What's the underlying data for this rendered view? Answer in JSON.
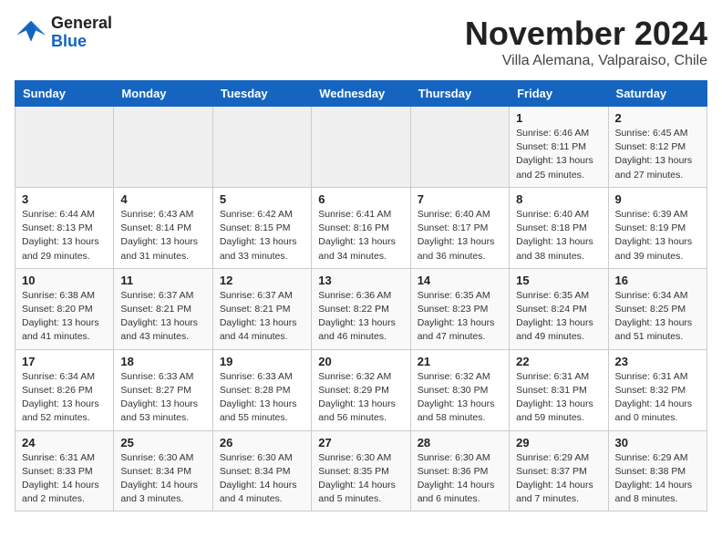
{
  "header": {
    "logo_general": "General",
    "logo_blue": "Blue",
    "month": "November 2024",
    "location": "Villa Alemana, Valparaiso, Chile"
  },
  "weekdays": [
    "Sunday",
    "Monday",
    "Tuesday",
    "Wednesday",
    "Thursday",
    "Friday",
    "Saturday"
  ],
  "weeks": [
    [
      {
        "day": "",
        "sunrise": "",
        "sunset": "",
        "daylight": ""
      },
      {
        "day": "",
        "sunrise": "",
        "sunset": "",
        "daylight": ""
      },
      {
        "day": "",
        "sunrise": "",
        "sunset": "",
        "daylight": ""
      },
      {
        "day": "",
        "sunrise": "",
        "sunset": "",
        "daylight": ""
      },
      {
        "day": "",
        "sunrise": "",
        "sunset": "",
        "daylight": ""
      },
      {
        "day": "1",
        "sunrise": "Sunrise: 6:46 AM",
        "sunset": "Sunset: 8:11 PM",
        "daylight": "Daylight: 13 hours and 25 minutes."
      },
      {
        "day": "2",
        "sunrise": "Sunrise: 6:45 AM",
        "sunset": "Sunset: 8:12 PM",
        "daylight": "Daylight: 13 hours and 27 minutes."
      }
    ],
    [
      {
        "day": "3",
        "sunrise": "Sunrise: 6:44 AM",
        "sunset": "Sunset: 8:13 PM",
        "daylight": "Daylight: 13 hours and 29 minutes."
      },
      {
        "day": "4",
        "sunrise": "Sunrise: 6:43 AM",
        "sunset": "Sunset: 8:14 PM",
        "daylight": "Daylight: 13 hours and 31 minutes."
      },
      {
        "day": "5",
        "sunrise": "Sunrise: 6:42 AM",
        "sunset": "Sunset: 8:15 PM",
        "daylight": "Daylight: 13 hours and 33 minutes."
      },
      {
        "day": "6",
        "sunrise": "Sunrise: 6:41 AM",
        "sunset": "Sunset: 8:16 PM",
        "daylight": "Daylight: 13 hours and 34 minutes."
      },
      {
        "day": "7",
        "sunrise": "Sunrise: 6:40 AM",
        "sunset": "Sunset: 8:17 PM",
        "daylight": "Daylight: 13 hours and 36 minutes."
      },
      {
        "day": "8",
        "sunrise": "Sunrise: 6:40 AM",
        "sunset": "Sunset: 8:18 PM",
        "daylight": "Daylight: 13 hours and 38 minutes."
      },
      {
        "day": "9",
        "sunrise": "Sunrise: 6:39 AM",
        "sunset": "Sunset: 8:19 PM",
        "daylight": "Daylight: 13 hours and 39 minutes."
      }
    ],
    [
      {
        "day": "10",
        "sunrise": "Sunrise: 6:38 AM",
        "sunset": "Sunset: 8:20 PM",
        "daylight": "Daylight: 13 hours and 41 minutes."
      },
      {
        "day": "11",
        "sunrise": "Sunrise: 6:37 AM",
        "sunset": "Sunset: 8:21 PM",
        "daylight": "Daylight: 13 hours and 43 minutes."
      },
      {
        "day": "12",
        "sunrise": "Sunrise: 6:37 AM",
        "sunset": "Sunset: 8:21 PM",
        "daylight": "Daylight: 13 hours and 44 minutes."
      },
      {
        "day": "13",
        "sunrise": "Sunrise: 6:36 AM",
        "sunset": "Sunset: 8:22 PM",
        "daylight": "Daylight: 13 hours and 46 minutes."
      },
      {
        "day": "14",
        "sunrise": "Sunrise: 6:35 AM",
        "sunset": "Sunset: 8:23 PM",
        "daylight": "Daylight: 13 hours and 47 minutes."
      },
      {
        "day": "15",
        "sunrise": "Sunrise: 6:35 AM",
        "sunset": "Sunset: 8:24 PM",
        "daylight": "Daylight: 13 hours and 49 minutes."
      },
      {
        "day": "16",
        "sunrise": "Sunrise: 6:34 AM",
        "sunset": "Sunset: 8:25 PM",
        "daylight": "Daylight: 13 hours and 51 minutes."
      }
    ],
    [
      {
        "day": "17",
        "sunrise": "Sunrise: 6:34 AM",
        "sunset": "Sunset: 8:26 PM",
        "daylight": "Daylight: 13 hours and 52 minutes."
      },
      {
        "day": "18",
        "sunrise": "Sunrise: 6:33 AM",
        "sunset": "Sunset: 8:27 PM",
        "daylight": "Daylight: 13 hours and 53 minutes."
      },
      {
        "day": "19",
        "sunrise": "Sunrise: 6:33 AM",
        "sunset": "Sunset: 8:28 PM",
        "daylight": "Daylight: 13 hours and 55 minutes."
      },
      {
        "day": "20",
        "sunrise": "Sunrise: 6:32 AM",
        "sunset": "Sunset: 8:29 PM",
        "daylight": "Daylight: 13 hours and 56 minutes."
      },
      {
        "day": "21",
        "sunrise": "Sunrise: 6:32 AM",
        "sunset": "Sunset: 8:30 PM",
        "daylight": "Daylight: 13 hours and 58 minutes."
      },
      {
        "day": "22",
        "sunrise": "Sunrise: 6:31 AM",
        "sunset": "Sunset: 8:31 PM",
        "daylight": "Daylight: 13 hours and 59 minutes."
      },
      {
        "day": "23",
        "sunrise": "Sunrise: 6:31 AM",
        "sunset": "Sunset: 8:32 PM",
        "daylight": "Daylight: 14 hours and 0 minutes."
      }
    ],
    [
      {
        "day": "24",
        "sunrise": "Sunrise: 6:31 AM",
        "sunset": "Sunset: 8:33 PM",
        "daylight": "Daylight: 14 hours and 2 minutes."
      },
      {
        "day": "25",
        "sunrise": "Sunrise: 6:30 AM",
        "sunset": "Sunset: 8:34 PM",
        "daylight": "Daylight: 14 hours and 3 minutes."
      },
      {
        "day": "26",
        "sunrise": "Sunrise: 6:30 AM",
        "sunset": "Sunset: 8:34 PM",
        "daylight": "Daylight: 14 hours and 4 minutes."
      },
      {
        "day": "27",
        "sunrise": "Sunrise: 6:30 AM",
        "sunset": "Sunset: 8:35 PM",
        "daylight": "Daylight: 14 hours and 5 minutes."
      },
      {
        "day": "28",
        "sunrise": "Sunrise: 6:30 AM",
        "sunset": "Sunset: 8:36 PM",
        "daylight": "Daylight: 14 hours and 6 minutes."
      },
      {
        "day": "29",
        "sunrise": "Sunrise: 6:29 AM",
        "sunset": "Sunset: 8:37 PM",
        "daylight": "Daylight: 14 hours and 7 minutes."
      },
      {
        "day": "30",
        "sunrise": "Sunrise: 6:29 AM",
        "sunset": "Sunset: 8:38 PM",
        "daylight": "Daylight: 14 hours and 8 minutes."
      }
    ]
  ]
}
